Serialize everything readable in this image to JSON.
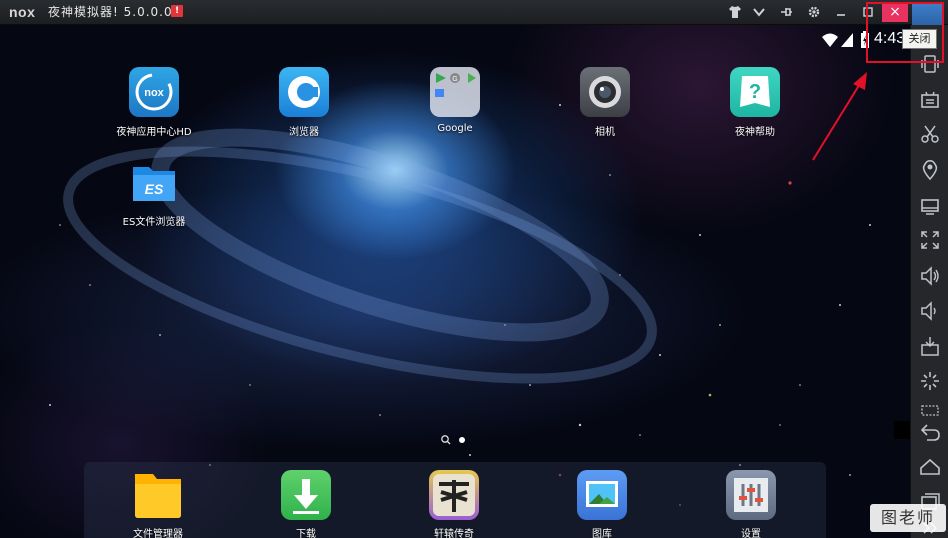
{
  "window": {
    "logo": "nox",
    "title": "夜神模拟器! 5.0.0.0",
    "alert_badge": "!",
    "buttons": [
      "tshirt-icon",
      "chevron-down-icon",
      "pin-icon",
      "gear-icon",
      "minimize-icon",
      "maximize-icon",
      "close-icon"
    ],
    "close_label": "×"
  },
  "status_bar": {
    "time": "4:43"
  },
  "tooltip": "关闭",
  "apps": [
    {
      "label": "夜神应用中心HD",
      "icon": "nox-app-center-icon"
    },
    {
      "label": "浏览器",
      "icon": "browser-icon"
    },
    {
      "label": "Google",
      "icon": "google-folder-icon"
    },
    {
      "label": "相机",
      "icon": "camera-icon"
    },
    {
      "label": "夜神帮助",
      "icon": "help-icon"
    },
    {
      "label": "ES文件浏览器",
      "icon": "es-file-explorer-icon"
    }
  ],
  "dock": [
    {
      "label": "文件管理器",
      "icon": "file-manager-icon"
    },
    {
      "label": "下载",
      "icon": "download-icon"
    },
    {
      "label": "轩辕传奇",
      "icon": "game-icon"
    },
    {
      "label": "图库",
      "icon": "gallery-icon"
    },
    {
      "label": "设置",
      "icon": "settings-icon"
    }
  ],
  "sidebar": [
    "shake-icon",
    "keyboard-icon",
    "scissors-icon",
    "location-icon",
    "screen-icon",
    "fullscreen-icon",
    "volume-up-icon",
    "volume-down-icon",
    "apk-install-icon",
    "loading-icon",
    "multi-window-icon",
    "back-icon",
    "home-icon",
    "recent-apps-icon",
    "more-icon"
  ],
  "watermark": "图老师",
  "colors": {
    "close_button": "#e8325f",
    "highlight": "#e3102a",
    "titlebar": "#1c1e21",
    "sidebar": "#25272b"
  }
}
